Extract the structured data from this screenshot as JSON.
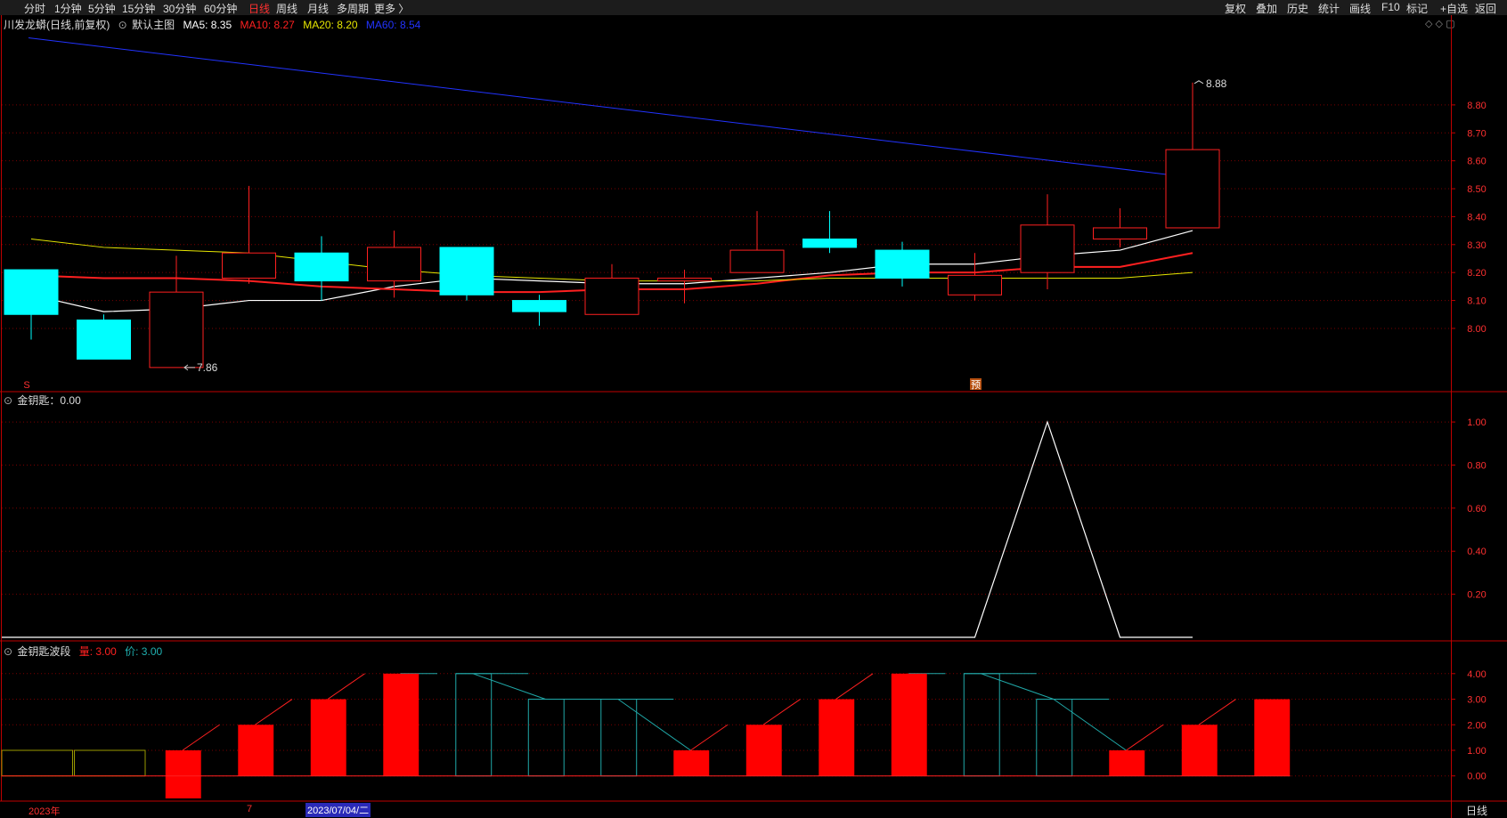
{
  "toolbar": {
    "periods": [
      "分时",
      "1分钟",
      "5分钟",
      "15分钟",
      "30分钟",
      "60分钟",
      "日线",
      "周线",
      "月线",
      "多周期",
      "更多 〉"
    ],
    "active_period": "日线",
    "right_buttons": [
      "复权",
      "叠加",
      "历史",
      "统计",
      "画线",
      "F10",
      "标记",
      "+自选",
      "返回"
    ]
  },
  "main_info": {
    "stock": "川发龙蟒(日线,前复权)",
    "template": "默认主图",
    "ma5": "MA5: 8.35",
    "ma10": "MA10: 8.27",
    "ma20": "MA20: 8.20",
    "ma60": "MA60: 8.54"
  },
  "ind1_info": {
    "label": "金钥匙：0.00"
  },
  "ind2_info": {
    "name": "金钥匙波段",
    "liang": "量: 3.00",
    "jia": "价: 3.00"
  },
  "markers": {
    "s_mark": "S",
    "yu_mark": "预",
    "high_label": "8.88",
    "low_label": "7.86"
  },
  "bottom": {
    "year": "2023年",
    "month": "7",
    "date": "2023/07/04/二",
    "period": "日线"
  },
  "colors": {
    "up": "#ff2020",
    "down": "#00ffff",
    "ma5": "#ffffff",
    "ma10": "#ff2020",
    "ma20": "#e6e600",
    "ma60": "#2233ff",
    "grid": "#7a0000"
  },
  "chart_data": [
    {
      "type": "candlestick",
      "title": "川发龙蟒(日线,前复权)",
      "ylim": [
        7.78,
        9.08
      ],
      "yticks": [
        "8.80",
        "8.70",
        "8.60",
        "8.50",
        "8.40",
        "8.30",
        "8.20",
        "8.10",
        "8.00"
      ],
      "candles": [
        {
          "o": 8.21,
          "h": 8.21,
          "l": 7.96,
          "c": 8.05
        },
        {
          "o": 8.03,
          "h": 8.05,
          "l": 7.89,
          "c": 7.89
        },
        {
          "o": 7.86,
          "h": 8.26,
          "l": 7.86,
          "c": 8.13
        },
        {
          "o": 8.18,
          "h": 8.51,
          "l": 8.16,
          "c": 8.27
        },
        {
          "o": 8.27,
          "h": 8.33,
          "l": 8.1,
          "c": 8.17
        },
        {
          "o": 8.17,
          "h": 8.35,
          "l": 8.11,
          "c": 8.29
        },
        {
          "o": 8.29,
          "h": 8.29,
          "l": 8.1,
          "c": 8.12
        },
        {
          "o": 8.1,
          "h": 8.12,
          "l": 8.01,
          "c": 8.06
        },
        {
          "o": 8.05,
          "h": 8.23,
          "l": 8.05,
          "c": 8.18
        },
        {
          "o": 8.17,
          "h": 8.21,
          "l": 8.09,
          "c": 8.18
        },
        {
          "o": 8.2,
          "h": 8.42,
          "l": 8.2,
          "c": 8.28
        },
        {
          "o": 8.32,
          "h": 8.42,
          "l": 8.27,
          "c": 8.29
        },
        {
          "o": 8.28,
          "h": 8.31,
          "l": 8.15,
          "c": 8.18
        },
        {
          "o": 8.12,
          "h": 8.27,
          "l": 8.1,
          "c": 8.19
        },
        {
          "o": 8.2,
          "h": 8.48,
          "l": 8.14,
          "c": 8.37
        },
        {
          "o": 8.32,
          "h": 8.43,
          "l": 8.29,
          "c": 8.36
        },
        {
          "o": 8.36,
          "h": 8.88,
          "l": 8.36,
          "c": 8.64
        }
      ],
      "series": [
        {
          "name": "MA5",
          "values": [
            8.12,
            8.06,
            8.07,
            8.1,
            8.1,
            8.15,
            8.18,
            8.17,
            8.16,
            8.16,
            8.18,
            8.2,
            8.23,
            8.23,
            8.26,
            8.28,
            8.35
          ]
        },
        {
          "name": "MA10",
          "values": [
            8.19,
            8.18,
            8.18,
            8.17,
            8.15,
            8.14,
            8.13,
            8.13,
            8.14,
            8.14,
            8.16,
            8.19,
            8.2,
            8.2,
            8.22,
            8.22,
            8.27
          ]
        },
        {
          "name": "MA20",
          "values": [
            8.32,
            8.29,
            8.28,
            8.27,
            8.24,
            8.21,
            8.19,
            8.18,
            8.17,
            8.17,
            8.17,
            8.18,
            8.18,
            8.18,
            8.18,
            8.18,
            8.2
          ]
        },
        {
          "name": "MA60",
          "values": [
            9.04,
            9.0,
            8.96,
            8.92,
            8.88,
            8.85,
            8.81,
            8.77,
            8.74,
            8.71,
            8.68,
            8.66,
            8.63,
            8.61,
            8.59,
            8.57,
            8.54
          ]
        }
      ]
    },
    {
      "type": "line",
      "title": "金钥匙",
      "ylim": [
        0,
        1.05
      ],
      "yticks": [
        "1.00",
        "0.80",
        "0.60",
        "0.40",
        "0.20"
      ],
      "values": [
        0,
        0,
        0,
        0,
        0,
        0,
        0,
        0,
        0,
        0,
        0,
        0,
        0,
        0,
        1,
        0,
        0
      ]
    },
    {
      "type": "bar",
      "title": "金钥匙波段",
      "ylim": [
        -0.95,
        4.55
      ],
      "yticks": [
        "4.00",
        "3.00",
        "2.00",
        "1.00",
        "0.00"
      ],
      "bars": [
        {
          "v": 1,
          "style": "olive"
        },
        {
          "v": 1,
          "style": "olive"
        },
        {
          "v": 1,
          "style": "red"
        },
        {
          "v": 2,
          "style": "red"
        },
        {
          "v": 3,
          "style": "red"
        },
        {
          "v": 4,
          "style": "red"
        },
        {
          "v": 4,
          "style": "hollow"
        },
        {
          "v": 3,
          "style": "hollow"
        },
        {
          "v": 3,
          "style": "hollow"
        },
        {
          "v": 1,
          "style": "red"
        },
        {
          "v": 2,
          "style": "red"
        },
        {
          "v": 3,
          "style": "red"
        },
        {
          "v": 4,
          "style": "red"
        },
        {
          "v": 4,
          "style": "hollow"
        },
        {
          "v": 3,
          "style": "hollow"
        },
        {
          "v": 1,
          "style": "red"
        },
        {
          "v": 2,
          "style": "red"
        },
        {
          "v": 3,
          "style": "red"
        }
      ]
    }
  ]
}
